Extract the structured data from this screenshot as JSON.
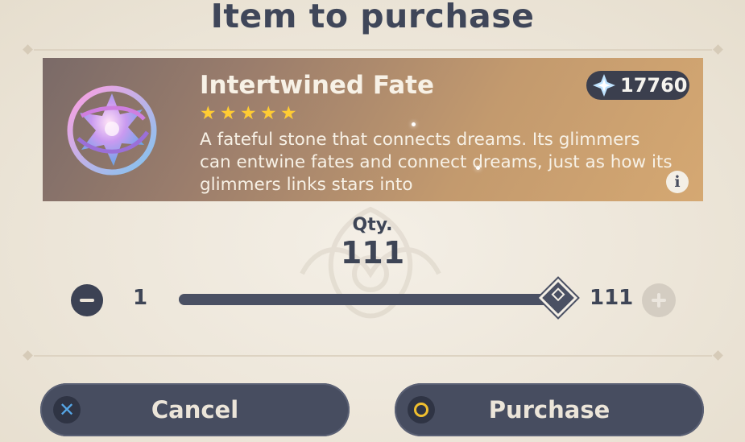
{
  "dialog": {
    "title": "Item to purchase"
  },
  "item": {
    "name": "Intertwined Fate",
    "rarity_stars": 5,
    "description": "A fateful stone that connects dreams. Its glimmers can entwine fates and connect dreams, just as how its glimmers links stars into",
    "icon": "intertwined-fate-icon"
  },
  "currency": {
    "icon": "primogem-icon",
    "amount": "17760"
  },
  "quantity": {
    "label": "Qty.",
    "value": "111",
    "min": "1",
    "max": "111",
    "slider_fraction": 1.0
  },
  "buttons": {
    "cancel_label": "Cancel",
    "purchase_label": "Purchase"
  },
  "colors": {
    "accent_dark": "#3c4254",
    "star": "#ffcc33",
    "cancel_icon": "#56a6e6",
    "confirm_icon": "#f0bf2f"
  }
}
